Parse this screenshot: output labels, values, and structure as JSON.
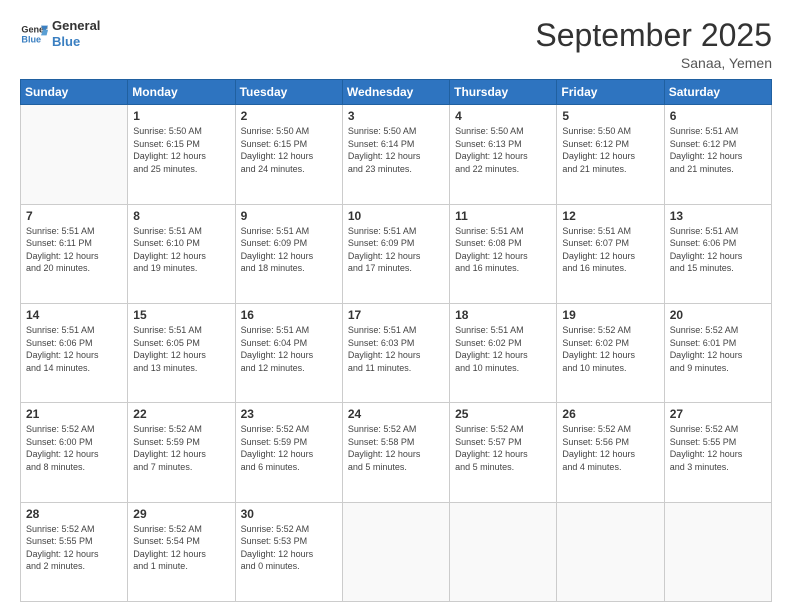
{
  "logo": {
    "line1": "General",
    "line2": "Blue"
  },
  "header": {
    "title": "September 2025",
    "subtitle": "Sanaa, Yemen"
  },
  "weekdays": [
    "Sunday",
    "Monday",
    "Tuesday",
    "Wednesday",
    "Thursday",
    "Friday",
    "Saturday"
  ],
  "weeks": [
    [
      {
        "day": "",
        "info": ""
      },
      {
        "day": "1",
        "info": "Sunrise: 5:50 AM\nSunset: 6:15 PM\nDaylight: 12 hours\nand 25 minutes."
      },
      {
        "day": "2",
        "info": "Sunrise: 5:50 AM\nSunset: 6:15 PM\nDaylight: 12 hours\nand 24 minutes."
      },
      {
        "day": "3",
        "info": "Sunrise: 5:50 AM\nSunset: 6:14 PM\nDaylight: 12 hours\nand 23 minutes."
      },
      {
        "day": "4",
        "info": "Sunrise: 5:50 AM\nSunset: 6:13 PM\nDaylight: 12 hours\nand 22 minutes."
      },
      {
        "day": "5",
        "info": "Sunrise: 5:50 AM\nSunset: 6:12 PM\nDaylight: 12 hours\nand 21 minutes."
      },
      {
        "day": "6",
        "info": "Sunrise: 5:51 AM\nSunset: 6:12 PM\nDaylight: 12 hours\nand 21 minutes."
      }
    ],
    [
      {
        "day": "7",
        "info": "Sunrise: 5:51 AM\nSunset: 6:11 PM\nDaylight: 12 hours\nand 20 minutes."
      },
      {
        "day": "8",
        "info": "Sunrise: 5:51 AM\nSunset: 6:10 PM\nDaylight: 12 hours\nand 19 minutes."
      },
      {
        "day": "9",
        "info": "Sunrise: 5:51 AM\nSunset: 6:09 PM\nDaylight: 12 hours\nand 18 minutes."
      },
      {
        "day": "10",
        "info": "Sunrise: 5:51 AM\nSunset: 6:09 PM\nDaylight: 12 hours\nand 17 minutes."
      },
      {
        "day": "11",
        "info": "Sunrise: 5:51 AM\nSunset: 6:08 PM\nDaylight: 12 hours\nand 16 minutes."
      },
      {
        "day": "12",
        "info": "Sunrise: 5:51 AM\nSunset: 6:07 PM\nDaylight: 12 hours\nand 16 minutes."
      },
      {
        "day": "13",
        "info": "Sunrise: 5:51 AM\nSunset: 6:06 PM\nDaylight: 12 hours\nand 15 minutes."
      }
    ],
    [
      {
        "day": "14",
        "info": "Sunrise: 5:51 AM\nSunset: 6:06 PM\nDaylight: 12 hours\nand 14 minutes."
      },
      {
        "day": "15",
        "info": "Sunrise: 5:51 AM\nSunset: 6:05 PM\nDaylight: 12 hours\nand 13 minutes."
      },
      {
        "day": "16",
        "info": "Sunrise: 5:51 AM\nSunset: 6:04 PM\nDaylight: 12 hours\nand 12 minutes."
      },
      {
        "day": "17",
        "info": "Sunrise: 5:51 AM\nSunset: 6:03 PM\nDaylight: 12 hours\nand 11 minutes."
      },
      {
        "day": "18",
        "info": "Sunrise: 5:51 AM\nSunset: 6:02 PM\nDaylight: 12 hours\nand 10 minutes."
      },
      {
        "day": "19",
        "info": "Sunrise: 5:52 AM\nSunset: 6:02 PM\nDaylight: 12 hours\nand 10 minutes."
      },
      {
        "day": "20",
        "info": "Sunrise: 5:52 AM\nSunset: 6:01 PM\nDaylight: 12 hours\nand 9 minutes."
      }
    ],
    [
      {
        "day": "21",
        "info": "Sunrise: 5:52 AM\nSunset: 6:00 PM\nDaylight: 12 hours\nand 8 minutes."
      },
      {
        "day": "22",
        "info": "Sunrise: 5:52 AM\nSunset: 5:59 PM\nDaylight: 12 hours\nand 7 minutes."
      },
      {
        "day": "23",
        "info": "Sunrise: 5:52 AM\nSunset: 5:59 PM\nDaylight: 12 hours\nand 6 minutes."
      },
      {
        "day": "24",
        "info": "Sunrise: 5:52 AM\nSunset: 5:58 PM\nDaylight: 12 hours\nand 5 minutes."
      },
      {
        "day": "25",
        "info": "Sunrise: 5:52 AM\nSunset: 5:57 PM\nDaylight: 12 hours\nand 5 minutes."
      },
      {
        "day": "26",
        "info": "Sunrise: 5:52 AM\nSunset: 5:56 PM\nDaylight: 12 hours\nand 4 minutes."
      },
      {
        "day": "27",
        "info": "Sunrise: 5:52 AM\nSunset: 5:55 PM\nDaylight: 12 hours\nand 3 minutes."
      }
    ],
    [
      {
        "day": "28",
        "info": "Sunrise: 5:52 AM\nSunset: 5:55 PM\nDaylight: 12 hours\nand 2 minutes."
      },
      {
        "day": "29",
        "info": "Sunrise: 5:52 AM\nSunset: 5:54 PM\nDaylight: 12 hours\nand 1 minute."
      },
      {
        "day": "30",
        "info": "Sunrise: 5:52 AM\nSunset: 5:53 PM\nDaylight: 12 hours\nand 0 minutes."
      },
      {
        "day": "",
        "info": ""
      },
      {
        "day": "",
        "info": ""
      },
      {
        "day": "",
        "info": ""
      },
      {
        "day": "",
        "info": ""
      }
    ]
  ]
}
